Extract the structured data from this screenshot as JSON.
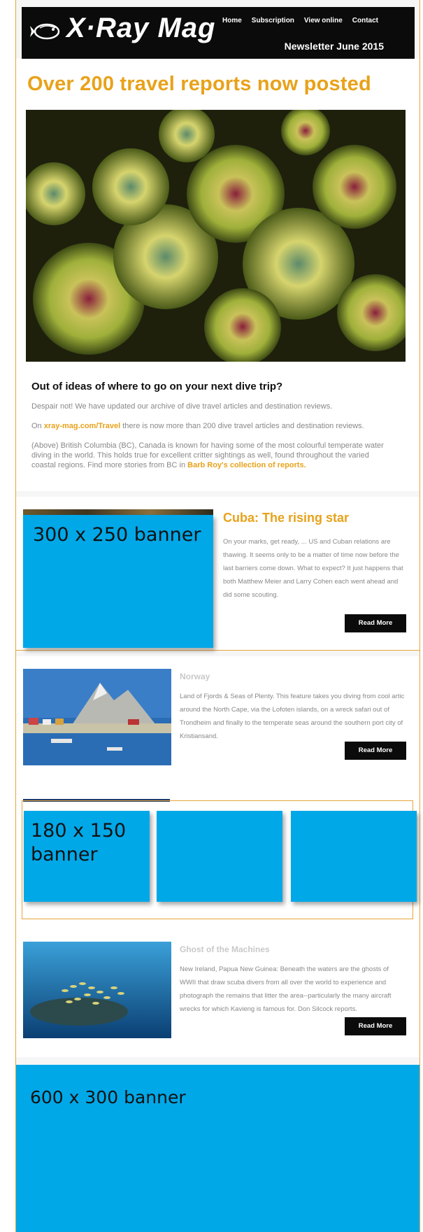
{
  "header": {
    "logo_text": "X·Ray Mag",
    "nav": [
      "Home",
      "Subscription",
      "View online",
      "Contact"
    ],
    "issue_label": "Newsletter June 2015"
  },
  "hero": {
    "title": "Over 200 travel reports now posted",
    "subtitle": "Out of ideas of where to go on your next dive trip?",
    "p1": "Despair not! We have updated our archive of dive travel articles and destination reviews.",
    "p2_link": "xray-mag.com/Travel",
    "p2_text": " there is now more than 200 dive travel articles and destination reviews.",
    "p2_prefix": "On ",
    "p3_text": "(Above) British Columbia (BC), Canada is known for having some of the most colourful temperate water diving in the world. This holds true for excellent critter sightings as well, found throughout the varied coastal regions. Find more stories from BC in ",
    "p3_link": "Barb Roy's collection of reports."
  },
  "cuba": {
    "banner_label": "300 x 250 banner",
    "title": "Cuba: The rising star",
    "text": "On your marks, get ready, ... US and Cuban relations are thawing. It seems only to be a matter of time now before the last barriers come down. What to expect? It just happens that both Matthew Meier and Larry Cohen each went ahead and did some scouting.",
    "button": "Read More"
  },
  "norway": {
    "title": "Norway",
    "text": "Land of Fjords & Seas of Plenty. This feature takes you diving from cool artic around the North Cape, via the Lofoten islands, on a wreck safari out of Trondheim and finally to the temperate seas around the southern port city of Kristiansand.",
    "button": "Read More"
  },
  "banners_small": {
    "label": "180 x 150 banner"
  },
  "ghost": {
    "title": "Ghost of the Machines",
    "text": "New Ireland, Papua New Guinea: Beneath the waters are the ghosts of WWII that draw scuba divers from all over the world to experience and photograph the remains that litter the area--particularly the many aircraft wrecks for which Kavieng is famous for. Don Silcock reports.",
    "button": "Read More"
  },
  "banner_large": {
    "label": "600 x 300 banner"
  },
  "colors": {
    "accent": "#e8a21a",
    "banner": "#00a8e8",
    "header_bg": "#0b0b0b"
  }
}
